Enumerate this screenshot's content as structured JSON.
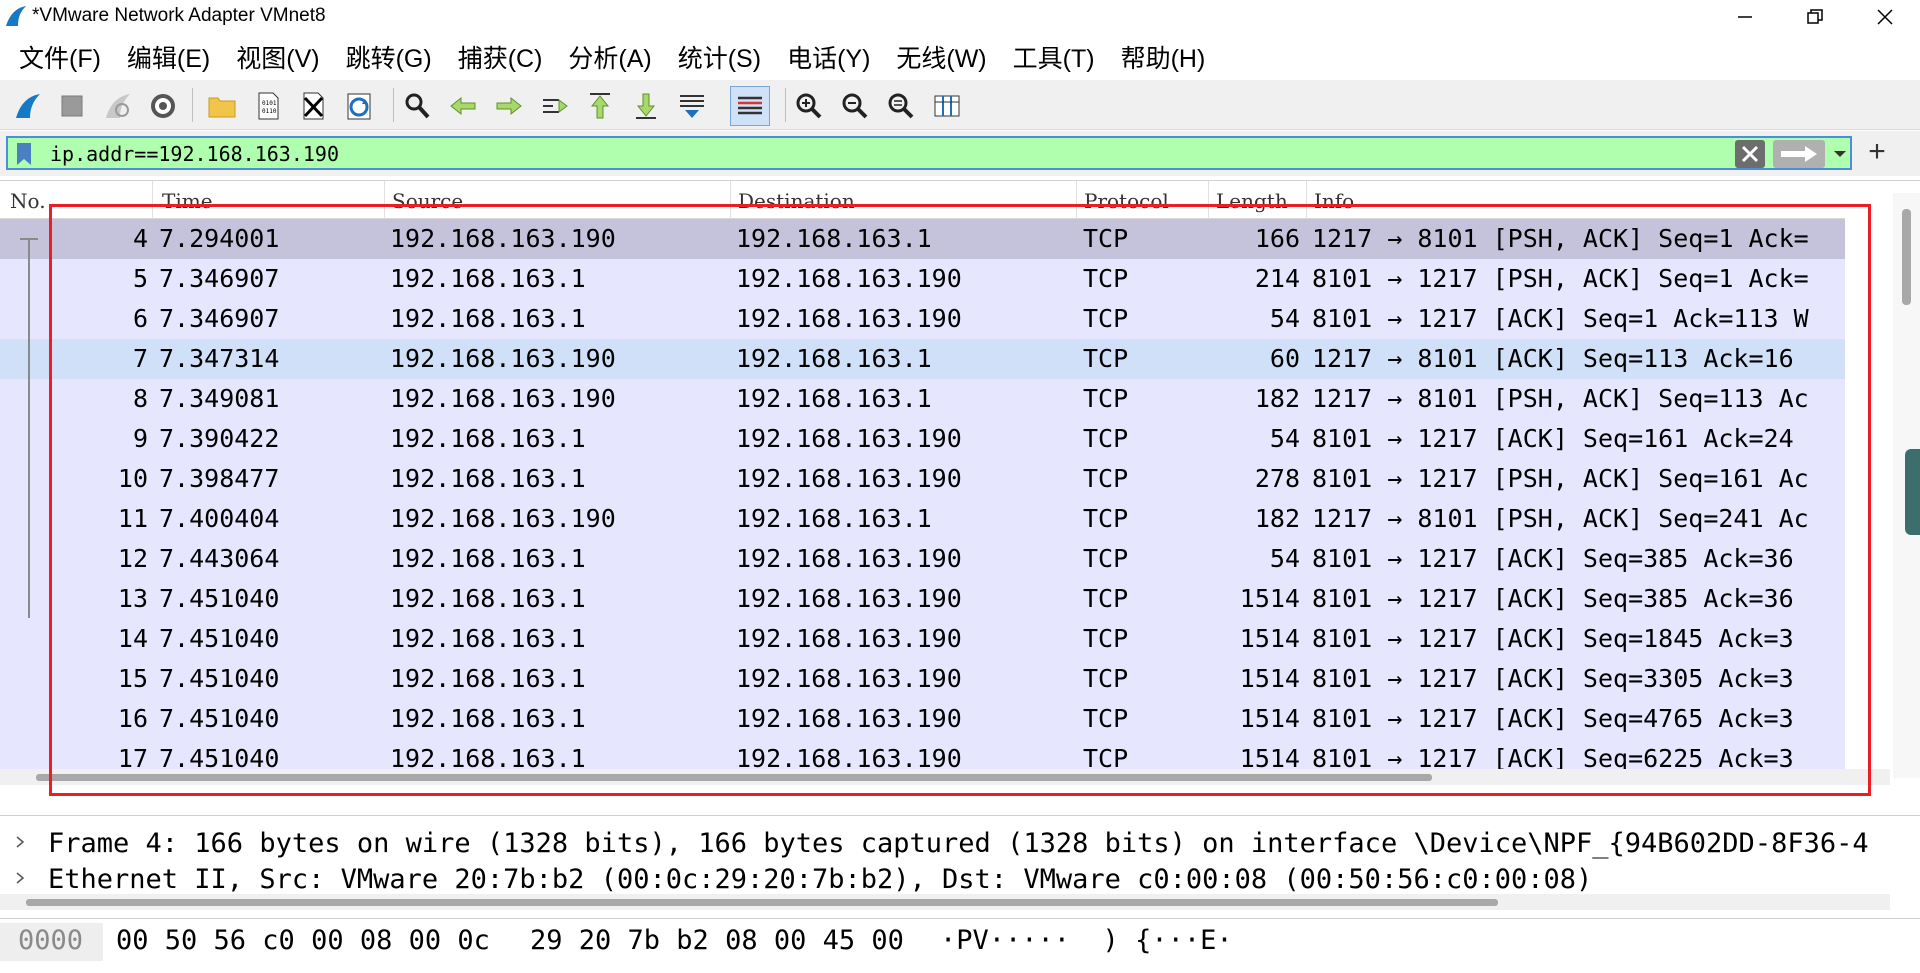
{
  "window": {
    "title": "*VMware Network Adapter VMnet8"
  },
  "menu": [
    {
      "label": "文件(F)"
    },
    {
      "label": "编辑(E)"
    },
    {
      "label": "视图(V)"
    },
    {
      "label": "跳转(G)"
    },
    {
      "label": "捕获(C)"
    },
    {
      "label": "分析(A)"
    },
    {
      "label": "统计(S)"
    },
    {
      "label": "电话(Y)"
    },
    {
      "label": "无线(W)"
    },
    {
      "label": "工具(T)"
    },
    {
      "label": "帮助(H)"
    }
  ],
  "toolbar_icons": [
    "start-capture-icon",
    "stop-capture-icon",
    "restart-capture-icon",
    "capture-options-icon",
    "open-file-icon",
    "file-info-icon",
    "close-file-icon",
    "reload-file-icon",
    "find-packet-icon",
    "go-back-icon",
    "go-forward-icon",
    "go-to-packet-icon",
    "first-packet-icon",
    "last-packet-icon",
    "autoscroll-icon",
    "colorize-icon",
    "zoom-in-icon",
    "zoom-out-icon",
    "normal-size-icon",
    "resize-columns-icon"
  ],
  "filter": {
    "value": "ip.addr==192.168.163.190",
    "bg_color": "#afffaf"
  },
  "packet_list": {
    "columns": [
      "No.",
      "Time",
      "Source",
      "Destination",
      "Protocol",
      "Length",
      "Info"
    ],
    "row_color": "#e7e6ff",
    "selected_color": "#c5c2db",
    "rows": [
      {
        "no": "4",
        "time": "7.294001",
        "src": "192.168.163.190",
        "dst": "192.168.163.1",
        "proto": "TCP",
        "len": "166",
        "info": "1217 → 8101 [PSH, ACK] Seq=1 Ack="
      },
      {
        "no": "5",
        "time": "7.346907",
        "src": "192.168.163.1",
        "dst": "192.168.163.190",
        "proto": "TCP",
        "len": "214",
        "info": "8101 → 1217 [PSH, ACK] Seq=1 Ack="
      },
      {
        "no": "6",
        "time": "7.346907",
        "src": "192.168.163.1",
        "dst": "192.168.163.190",
        "proto": "TCP",
        "len": "54",
        "info": "8101 → 1217 [ACK] Seq=1 Ack=113 W"
      },
      {
        "no": "7",
        "time": "7.347314",
        "src": "192.168.163.190",
        "dst": "192.168.163.1",
        "proto": "TCP",
        "len": "60",
        "info": "1217 → 8101 [ACK] Seq=113 Ack=16"
      },
      {
        "no": "8",
        "time": "7.349081",
        "src": "192.168.163.190",
        "dst": "192.168.163.1",
        "proto": "TCP",
        "len": "182",
        "info": "1217 → 8101 [PSH, ACK] Seq=113 Ac"
      },
      {
        "no": "9",
        "time": "7.390422",
        "src": "192.168.163.1",
        "dst": "192.168.163.190",
        "proto": "TCP",
        "len": "54",
        "info": "8101 → 1217 [ACK] Seq=161 Ack=24"
      },
      {
        "no": "10",
        "time": "7.398477",
        "src": "192.168.163.1",
        "dst": "192.168.163.190",
        "proto": "TCP",
        "len": "278",
        "info": "8101 → 1217 [PSH, ACK] Seq=161 Ac"
      },
      {
        "no": "11",
        "time": "7.400404",
        "src": "192.168.163.190",
        "dst": "192.168.163.1",
        "proto": "TCP",
        "len": "182",
        "info": "1217 → 8101 [PSH, ACK] Seq=241 Ac"
      },
      {
        "no": "12",
        "time": "7.443064",
        "src": "192.168.163.1",
        "dst": "192.168.163.190",
        "proto": "TCP",
        "len": "54",
        "info": "8101 → 1217 [ACK] Seq=385 Ack=36"
      },
      {
        "no": "13",
        "time": "7.451040",
        "src": "192.168.163.1",
        "dst": "192.168.163.190",
        "proto": "TCP",
        "len": "1514",
        "info": "8101 → 1217 [ACK] Seq=385 Ack=36"
      },
      {
        "no": "14",
        "time": "7.451040",
        "src": "192.168.163.1",
        "dst": "192.168.163.190",
        "proto": "TCP",
        "len": "1514",
        "info": "8101 → 1217 [ACK] Seq=1845 Ack=3"
      },
      {
        "no": "15",
        "time": "7.451040",
        "src": "192.168.163.1",
        "dst": "192.168.163.190",
        "proto": "TCP",
        "len": "1514",
        "info": "8101 → 1217 [ACK] Seq=3305 Ack=3"
      },
      {
        "no": "16",
        "time": "7.451040",
        "src": "192.168.163.1",
        "dst": "192.168.163.190",
        "proto": "TCP",
        "len": "1514",
        "info": "8101 → 1217 [ACK] Seq=4765 Ack=3"
      },
      {
        "no": "17",
        "time": "7.451040",
        "src": "192.168.163.1",
        "dst": "192.168.163.190",
        "proto": "TCP",
        "len": "1514",
        "info": "8101 → 1217 [ACK] Seq=6225 Ack=3"
      }
    ]
  },
  "details": {
    "lines": [
      "Frame 4: 166 bytes on wire (1328 bits), 166 bytes captured (1328 bits) on interface \\Device\\NPF_{94B602DD-8F36-4",
      "Ethernet II, Src: VMware_20:7b:b2 (00:0c:29:20:7b:b2), Dst: VMware_c0:00:08 (00:50:56:c0:00:08)"
    ]
  },
  "bytes": {
    "offset": "0000",
    "hex_a": "00 50 56 c0 00 08 00 0c",
    "hex_b": "29 20 7b b2 08 00 45 00",
    "ascii": "·PV·····  ) {···E·"
  },
  "annotation_color": "#ee1c25"
}
